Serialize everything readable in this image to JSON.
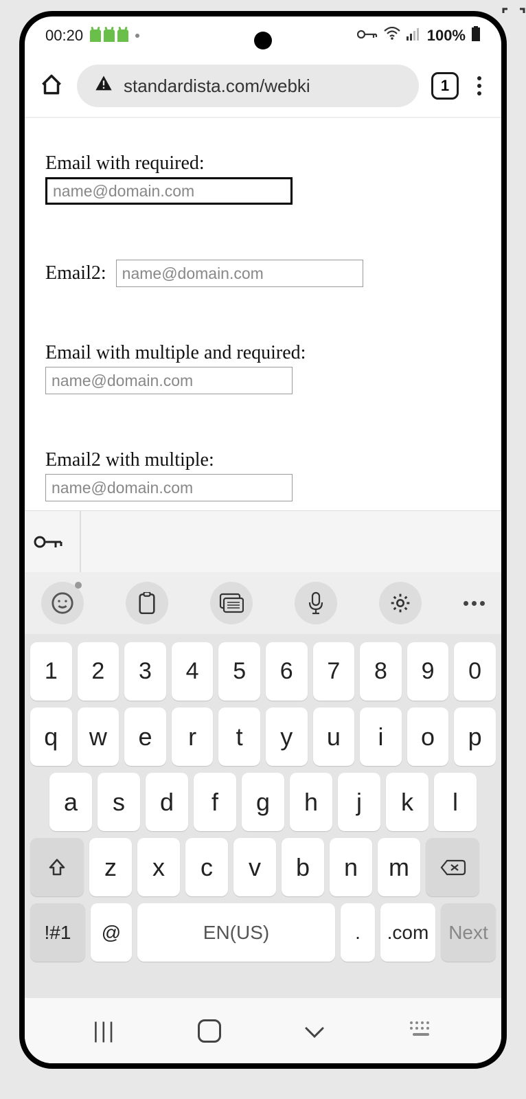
{
  "status": {
    "time": "00:20",
    "battery": "100%"
  },
  "browser": {
    "url": "standardista.com/webki",
    "tab_count": "1"
  },
  "form": {
    "field1": {
      "label": "Email with required:",
      "placeholder": "name@domain.com"
    },
    "field2": {
      "label": "Email2:",
      "placeholder": "name@domain.com"
    },
    "field3": {
      "label": "Email with multiple and required:",
      "placeholder": "name@domain.com"
    },
    "field4": {
      "label": "Email2 with multiple:",
      "placeholder": "name@domain.com"
    }
  },
  "keyboard": {
    "row1": [
      "1",
      "2",
      "3",
      "4",
      "5",
      "6",
      "7",
      "8",
      "9",
      "0"
    ],
    "row2": [
      "q",
      "w",
      "e",
      "r",
      "t",
      "y",
      "u",
      "i",
      "o",
      "p"
    ],
    "row3": [
      "a",
      "s",
      "d",
      "f",
      "g",
      "h",
      "j",
      "k",
      "l"
    ],
    "row4": [
      "z",
      "x",
      "c",
      "v",
      "b",
      "n",
      "m"
    ],
    "symbols_label": "!#1",
    "at_label": "@",
    "space_label": "EN(US)",
    "dot_label": ".",
    "com_label": ".com",
    "next_label": "Next"
  }
}
